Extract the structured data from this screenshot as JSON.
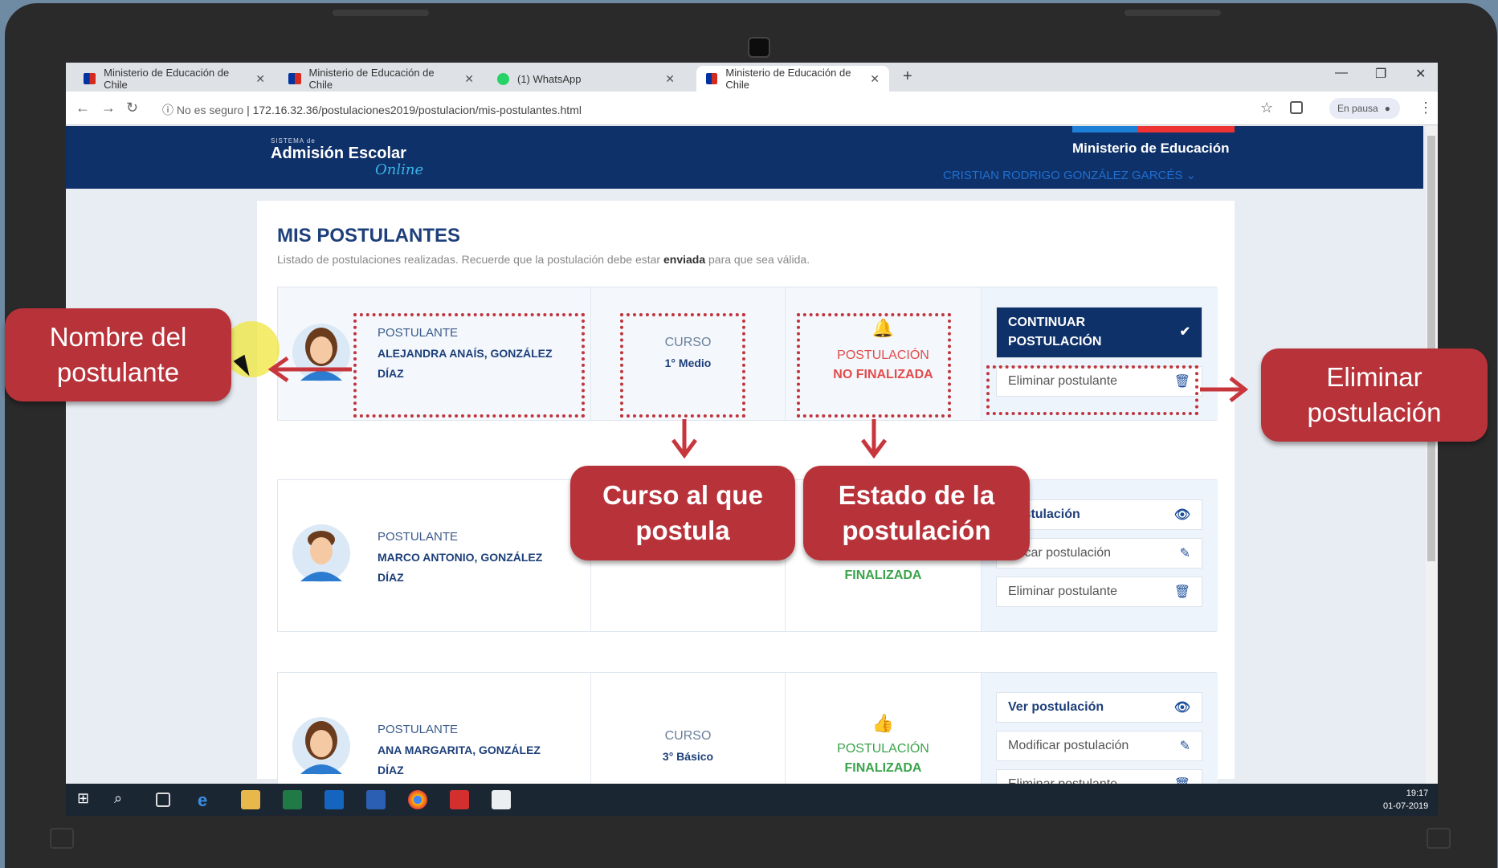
{
  "browser": {
    "tabs": [
      {
        "label": "Ministerio de Educación de Chile",
        "icon": "chile-flag-icon"
      },
      {
        "label": "Ministerio de Educación de Chile",
        "icon": "chile-flag-icon"
      },
      {
        "label": "(1) WhatsApp",
        "icon": "whatsapp-icon"
      },
      {
        "label": "Ministerio de Educación de Chile",
        "icon": "chile-flag-icon"
      }
    ],
    "security": "No es seguro",
    "url": "172.16.32.36/postulaciones2019/postulacion/mis-postulantes.html",
    "profile_status": "En pausa"
  },
  "site": {
    "logo_small": "SISTEMA de",
    "logo_main": "Admisión Escolar",
    "logo_online": "Online",
    "ministerio": "Ministerio de Educación",
    "user": "CRISTIAN RODRIGO GONZÁLEZ GARCÉS"
  },
  "page": {
    "title": "MIS POSTULANTES",
    "subtitle_pre": "Listado de postulaciones realizadas. Recuerde que la postulación debe estar ",
    "subtitle_bold": "enviada",
    "subtitle_post": " para que sea válida."
  },
  "rows": [
    {
      "label": "POSTULANTE",
      "name": "ALEJANDRA ANAÍS, GONZÁLEZ DÍAZ",
      "curso_label": "CURSO",
      "curso": "1° Medio",
      "state_label": "POSTULACIÓN",
      "state": "NO FINALIZADA",
      "actions": {
        "continue": "CONTINUAR POSTULACIÓN",
        "delete": "Eliminar postulante"
      }
    },
    {
      "label": "POSTULANTE",
      "name": "MARCO ANTONIO, GONZÁLEZ DÍAZ",
      "state": "FINALIZADA",
      "actions": {
        "view": "postulación",
        "modify": "dificar postulación",
        "delete": "Eliminar postulante"
      }
    },
    {
      "label": "POSTULANTE",
      "name": "ANA MARGARITA, GONZÁLEZ DÍAZ",
      "curso_label": "CURSO",
      "curso": "3° Básico",
      "state_label": "POSTULACIÓN",
      "state": "FINALIZADA",
      "actions": {
        "view": "Ver postulación",
        "modify": "Modificar postulación",
        "delete": "Eliminar postulante"
      }
    }
  ],
  "callouts": {
    "nombre": [
      "Nombre del",
      "postulante"
    ],
    "eliminar": [
      "Eliminar",
      "postulación"
    ],
    "curso": [
      "Curso al que",
      "postula"
    ],
    "estado": [
      "Estado de la",
      "postulación"
    ]
  },
  "taskbar": {
    "time": "19:17",
    "date": "01-07-2019"
  },
  "colors": {
    "accent_red": "#b8323a",
    "header_blue": "#0f3169",
    "green": "#3aa34b"
  }
}
